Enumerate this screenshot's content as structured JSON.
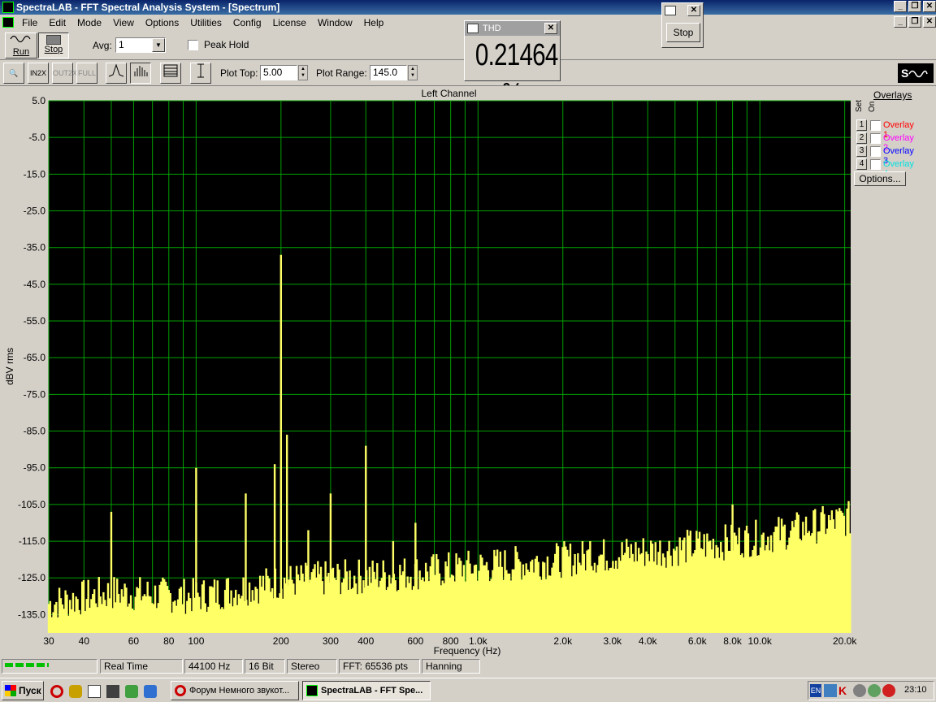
{
  "window": {
    "title": "SpectraLAB - FFT Spectral Analysis System - [Spectrum]"
  },
  "menu": [
    "File",
    "Edit",
    "Mode",
    "View",
    "Options",
    "Utilities",
    "Config",
    "License",
    "Window",
    "Help"
  ],
  "toolbar": {
    "run_label": "Run",
    "stop_label": "Stop",
    "avg_label": "Avg:",
    "avg_value": "1",
    "peak_hold_label": "Peak Hold",
    "plot_top_label": "Plot Top:",
    "plot_top_value": "5.00",
    "plot_range_label": "Plot Range:",
    "plot_range_value": "145.0"
  },
  "thd_window": {
    "title": "THD",
    "value": "0.21464 %"
  },
  "mini_window": {
    "stop_label": "Stop"
  },
  "overlays": {
    "title": "Overlays",
    "set_label": "Set",
    "on_label": "On",
    "items": [
      {
        "num": "1",
        "label": "Overlay 1",
        "color": "#ff0000"
      },
      {
        "num": "2",
        "label": "Overlay 2",
        "color": "#ff00ff"
      },
      {
        "num": "3",
        "label": "Overlay 3",
        "color": "#0000ff"
      },
      {
        "num": "4",
        "label": "Overlay 4",
        "color": "#00e0e0"
      }
    ],
    "options_label": "Options..."
  },
  "chart_data": {
    "type": "bar",
    "title": "Left Channel",
    "xlabel": "Frequency (Hz)",
    "ylabel": "dBV rms",
    "x_scale": "log",
    "xlim": [
      30,
      21000
    ],
    "ylim": [
      -140,
      5
    ],
    "y_ticks": [
      "5.0",
      "-5.0",
      "-15.0",
      "-25.0",
      "-35.0",
      "-45.0",
      "-55.0",
      "-65.0",
      "-75.0",
      "-85.0",
      "-95.0",
      "-105.0",
      "-115.0",
      "-125.0",
      "-135.0"
    ],
    "x_ticks": [
      {
        "v": 30,
        "label": "30"
      },
      {
        "v": 40,
        "label": "40"
      },
      {
        "v": 60,
        "label": "60"
      },
      {
        "v": 80,
        "label": "80"
      },
      {
        "v": 100,
        "label": "100"
      },
      {
        "v": 200,
        "label": "200"
      },
      {
        "v": 300,
        "label": "300"
      },
      {
        "v": 400,
        "label": "400"
      },
      {
        "v": 600,
        "label": "600"
      },
      {
        "v": 800,
        "label": "800"
      },
      {
        "v": 1000,
        "label": "1.0k"
      },
      {
        "v": 2000,
        "label": "2.0k"
      },
      {
        "v": 3000,
        "label": "3.0k"
      },
      {
        "v": 4000,
        "label": "4.0k"
      },
      {
        "v": 6000,
        "label": "6.0k"
      },
      {
        "v": 8000,
        "label": "8.0k"
      },
      {
        "v": 10000,
        "label": "10.0k"
      },
      {
        "v": 20000,
        "label": "20.0k"
      }
    ],
    "grid": true,
    "bar_color": "#ffff66",
    "grid_color": "#00a000",
    "peaks": [
      {
        "x": 50,
        "y": -107
      },
      {
        "x": 100,
        "y": -95
      },
      {
        "x": 150,
        "y": -102
      },
      {
        "x": 190,
        "y": -94
      },
      {
        "x": 200,
        "y": -37
      },
      {
        "x": 210,
        "y": -86
      },
      {
        "x": 250,
        "y": -112
      },
      {
        "x": 300,
        "y": -102
      },
      {
        "x": 400,
        "y": -89
      },
      {
        "x": 500,
        "y": -115
      },
      {
        "x": 600,
        "y": -110
      },
      {
        "x": 2500,
        "y": -115
      },
      {
        "x": 8000,
        "y": -105
      }
    ],
    "noise_floor": [
      {
        "x": 30,
        "y": -132
      },
      {
        "x": 50,
        "y": -129
      },
      {
        "x": 100,
        "y": -130
      },
      {
        "x": 200,
        "y": -126
      },
      {
        "x": 500,
        "y": -124
      },
      {
        "x": 1000,
        "y": -122
      },
      {
        "x": 2000,
        "y": -120
      },
      {
        "x": 5000,
        "y": -117
      },
      {
        "x": 10000,
        "y": -114
      },
      {
        "x": 20000,
        "y": -109
      }
    ]
  },
  "status": {
    "mode": "Real Time",
    "sample_rate": "44100 Hz",
    "bits": "16 Bit",
    "channels": "Stereo",
    "fft": "FFT: 65536 pts",
    "window": "Hanning"
  },
  "taskbar": {
    "start_label": "Пуск",
    "task1": "Форум Немного звукот...",
    "task2": "SpectraLAB - FFT Spe...",
    "lang": "EN",
    "time": "23:10"
  }
}
